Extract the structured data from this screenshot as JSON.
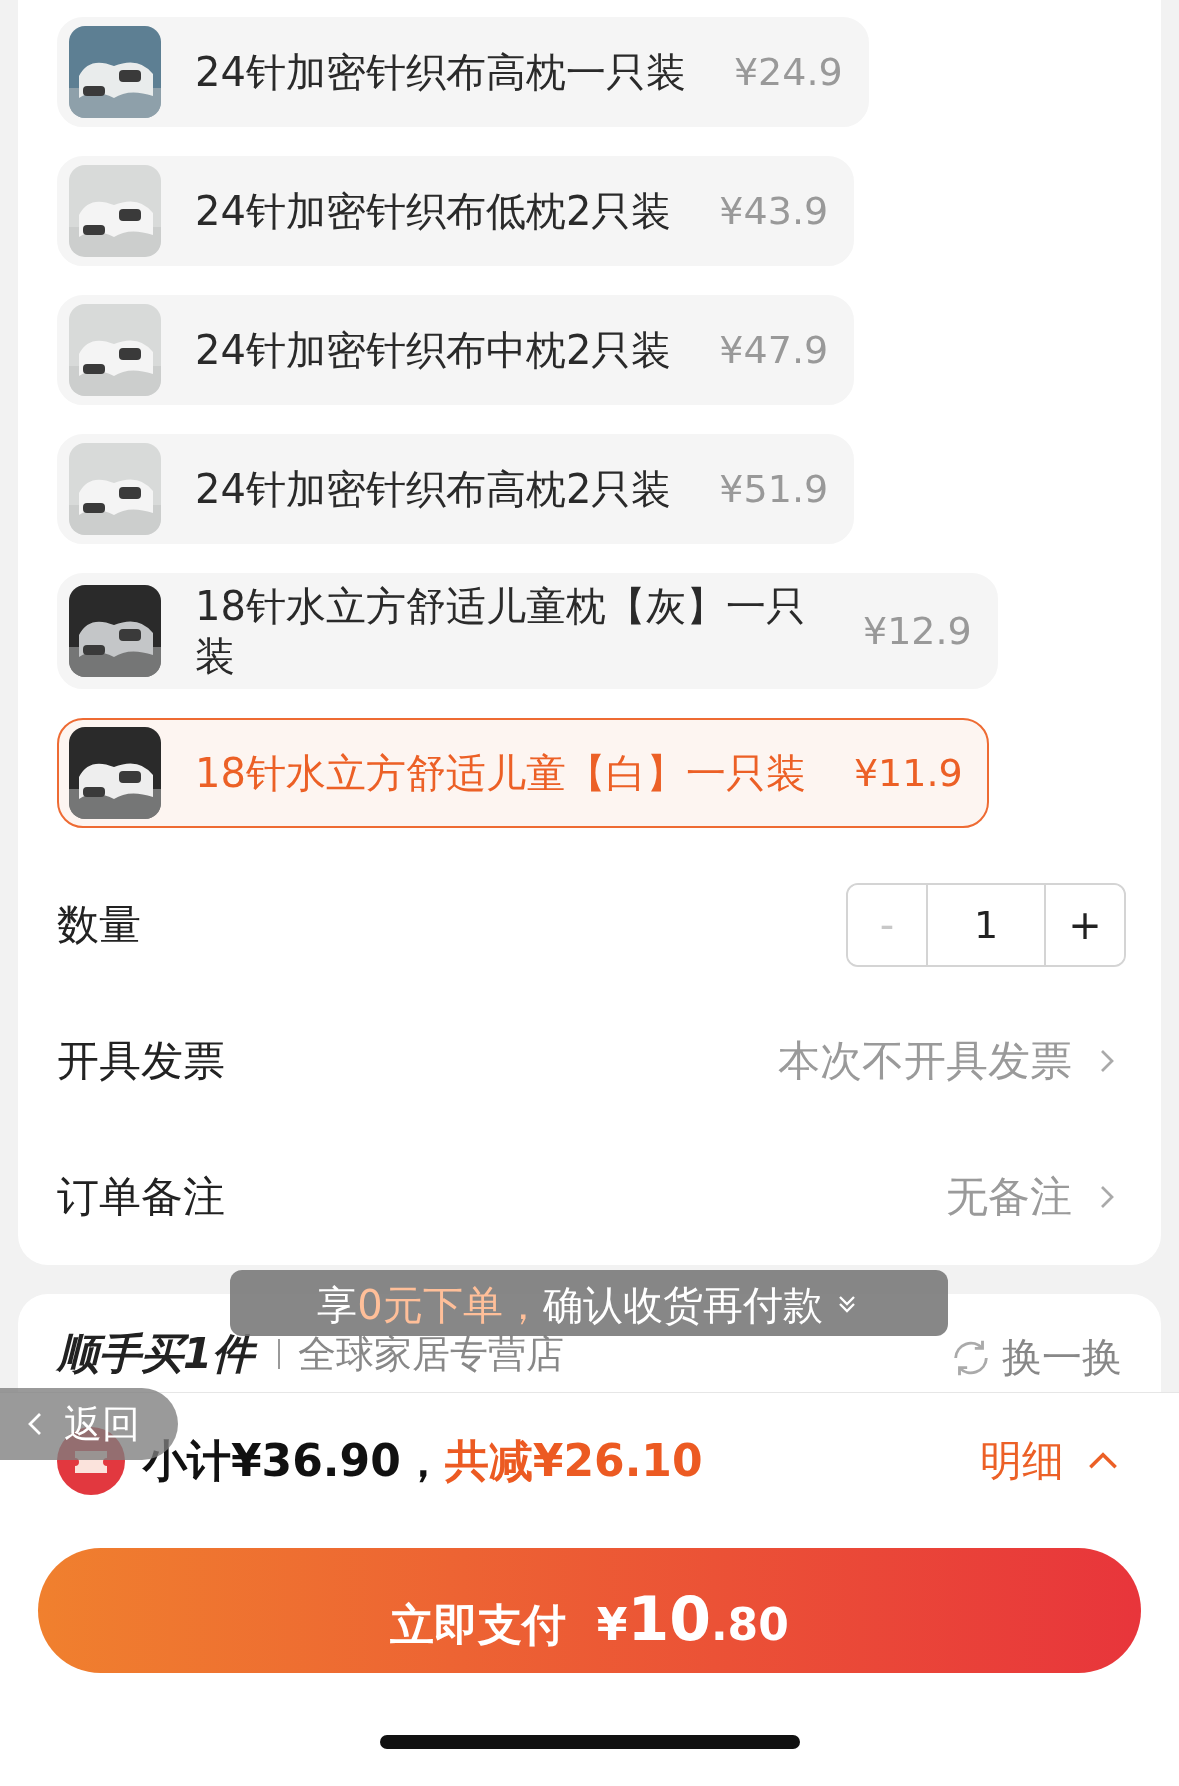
{
  "options": [
    {
      "name": "24针加密针织布高枕一只装",
      "price": "¥24.9",
      "selected": false,
      "kind": "picture"
    },
    {
      "name": "24针加密针织布低枕2只装",
      "price": "¥43.9",
      "selected": false,
      "kind": "picture"
    },
    {
      "name": "24针加密针织布中枕2只装",
      "price": "¥47.9",
      "selected": false,
      "kind": "picture"
    },
    {
      "name": "24针加密针织布高枕2只装",
      "price": "¥51.9",
      "selected": false,
      "kind": "picture"
    },
    {
      "name": "18针水立方舒适儿童枕【灰】一只装",
      "price": "¥12.9",
      "selected": false,
      "kind": "picture"
    },
    {
      "name": "18针水立方舒适儿童【白】一只装",
      "price": "¥11.9",
      "selected": true,
      "kind": "picture"
    }
  ],
  "quantity": {
    "label": "数量",
    "value": "1",
    "decrement": {
      "symbol": "-",
      "disabled": true
    },
    "increment": {
      "symbol": "+",
      "disabled": false
    }
  },
  "settings": [
    {
      "label": "开具发票",
      "value": "本次不开具发票"
    },
    {
      "label": "订单备注",
      "value": "无备注"
    }
  ],
  "toast": {
    "prefix": "享",
    "highlight": "0元下单，",
    "suffix": "确认收货再付款"
  },
  "add_on": {
    "title": "顺手买1件",
    "store": "全球家居专营店",
    "refresh": "换一换"
  },
  "back_button": {
    "label": "返回"
  },
  "summary": {
    "subtotal": "小计¥36.90，",
    "discount": "共减¥26.10",
    "details": "明细"
  },
  "pay_button": {
    "label": "立即支付",
    "currency": "¥",
    "integer": "10",
    "decimal": ".80"
  }
}
